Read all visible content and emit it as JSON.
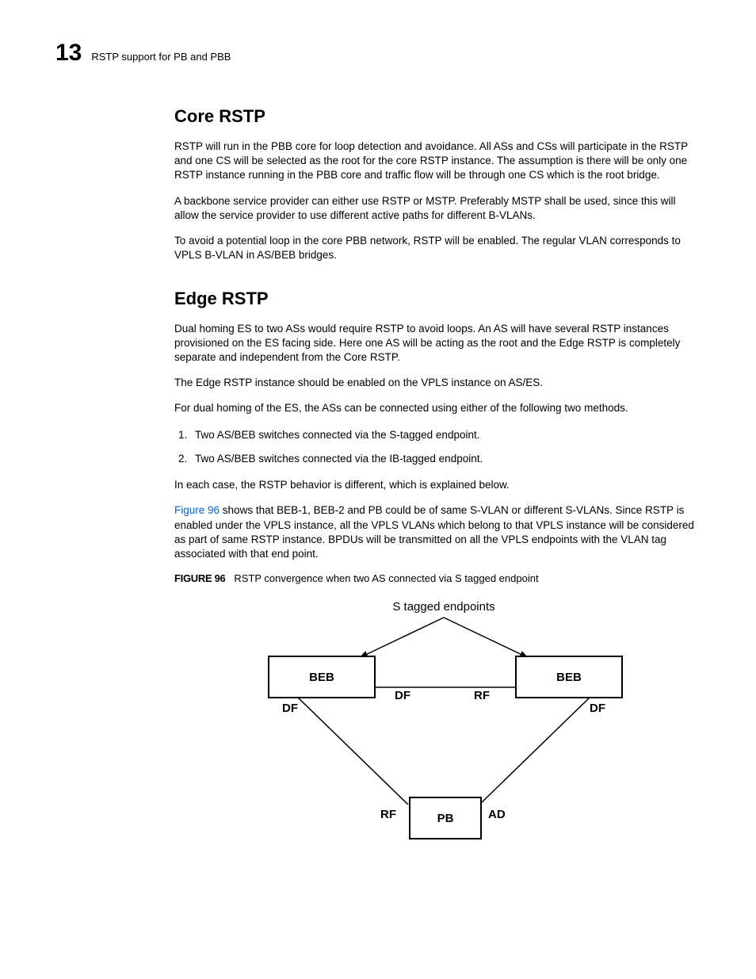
{
  "header": {
    "chapter": "13",
    "running": "RSTP support for PB and PBB"
  },
  "sections": {
    "core": {
      "title": "Core RSTP",
      "p1": "RSTP will run in the PBB core for loop detection and avoidance. All ASs and CSs will participate in the RSTP and one CS will be selected as the root for the core RSTP instance. The assumption is there will be only one RSTP instance running in the PBB core and traffic flow will be through one CS which is the root bridge.",
      "p2": "A backbone service provider can either use RSTP or MSTP. Preferably MSTP shall be used, since this will allow the service provider to use different active paths for different B-VLANs.",
      "p3": "To avoid a potential loop in the core PBB network, RSTP will be enabled. The regular VLAN corresponds to VPLS B-VLAN in AS/BEB bridges."
    },
    "edge": {
      "title": "Edge RSTP",
      "p1": "Dual homing ES to two ASs would require RSTP to avoid loops. An AS will have several RSTP instances provisioned on the ES facing side. Here one AS will be acting as the root and the Edge RSTP is completely separate and independent from the Core RSTP.",
      "p2": "The Edge RSTP instance should be enabled on the VPLS instance on AS/ES.",
      "p3": "For dual homing of the ES, the ASs can be connected using either of the following two methods.",
      "li1": "Two AS/BEB switches connected via the S-tagged endpoint.",
      "li2": "Two AS/BEB switches connected via the IB-tagged endpoint.",
      "p4": "In each case, the RSTP behavior is different, which is explained below.",
      "p5a": "Figure 96",
      "p5b": " shows that BEB-1, BEB-2 and PB could be of same S-VLAN or different S-VLANs. Since RSTP is enabled under the VPLS instance, all the VPLS VLANs which belong to that VPLS instance will be considered as part of same RSTP instance. BPDUs will be transmitted on all the VPLS endpoints with the VLAN tag associated with that end point."
    }
  },
  "figure": {
    "label": "FIGURE 96",
    "caption": "RSTP convergence when two AS connected via S tagged endpoint",
    "title": "S tagged endpoints",
    "nodes": {
      "beb1": "BEB",
      "beb2": "BEB",
      "pb": "PB"
    },
    "labels": {
      "df_top": "DF",
      "rf_top": "RF",
      "df_left": "DF",
      "df_right": "DF",
      "rf_bottom": "RF",
      "ad_bottom": "AD"
    }
  }
}
